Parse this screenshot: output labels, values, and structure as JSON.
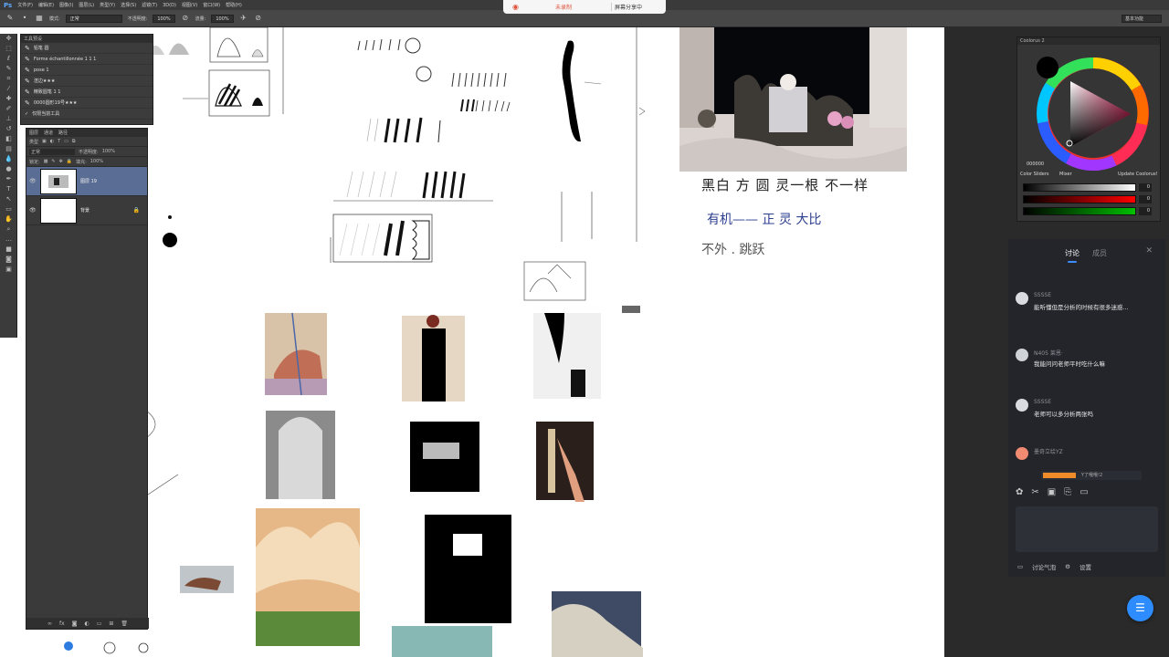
{
  "app": {
    "logo": "Ps",
    "menus": [
      "文件(F)",
      "编辑(E)",
      "图像(I)",
      "图层(L)",
      "类型(Y)",
      "选择(S)",
      "滤镜(T)",
      "3D(D)",
      "视图(V)",
      "窗口(W)",
      "帮助(H)"
    ],
    "workspace": "基本功能"
  },
  "options_bar": {
    "mode_label": "模式:",
    "mode_value": "正常",
    "opacity_label": "不透明度:",
    "opacity_value": "100%",
    "flow_label": "流量:",
    "flow_value": "100%"
  },
  "recording": {
    "status": "未录制",
    "share_status": "屏幕分享中"
  },
  "tool_presets": {
    "tabs": [
      "工具预设"
    ],
    "items": [
      "铅笔 圆",
      "Forme échantillonnée 1 1 1",
      "pose 1",
      "渲边★★★",
      "精致圆笔 1 1",
      "0000圆形19号★★★",
      "仅限当前工具"
    ]
  },
  "layers": {
    "tabs": [
      "图层",
      "通道",
      "路径"
    ],
    "kind_label": "类型",
    "blend_mode": "正常",
    "opacity_label": "不透明度:",
    "opacity_value": "100%",
    "lock_label": "锁定:",
    "fill_label": "填充:",
    "fill_value": "100%",
    "items": [
      {
        "name": "图层 19",
        "selected": true
      },
      {
        "name": "背景",
        "selected": false
      }
    ]
  },
  "color_panel": {
    "title": "Coolorus 2",
    "hex_value": "000000",
    "tabs": [
      "Color Sliders",
      "Mixer",
      "Update Coolorus!"
    ],
    "slider_values": [
      "0",
      "0",
      "0",
      "0"
    ]
  },
  "chat": {
    "tabs": [
      "讨论",
      "成员"
    ],
    "messages": [
      {
        "name": "SSSSE",
        "text": "能听懂但是分析的时候有很多迷惑...",
        "avatar_color": "#d9dbe0"
      },
      {
        "name": "N405 莱恩·",
        "text": "我能问问老师平时吃什么嘛",
        "avatar_color": "#cfd2d7"
      },
      {
        "name": "SSSSE",
        "text": "老师可以多分析两张吗",
        "avatar_color": "#d9dbe0"
      },
      {
        "name": "墨奇立绘YZ",
        "text": "",
        "avatar_color": "#f08b72"
      }
    ],
    "reply_tag": "Y了哦哦!2",
    "footer": {
      "bubble_label": "讨论气泡",
      "settings_label": "设置"
    }
  },
  "canvas_notes": {
    "main_heading": "黑白 方 圆  灵一根  不一样",
    "heading_line2": "有机——  正  灵  大比",
    "heading_line3": "不外  .  跳跃"
  }
}
